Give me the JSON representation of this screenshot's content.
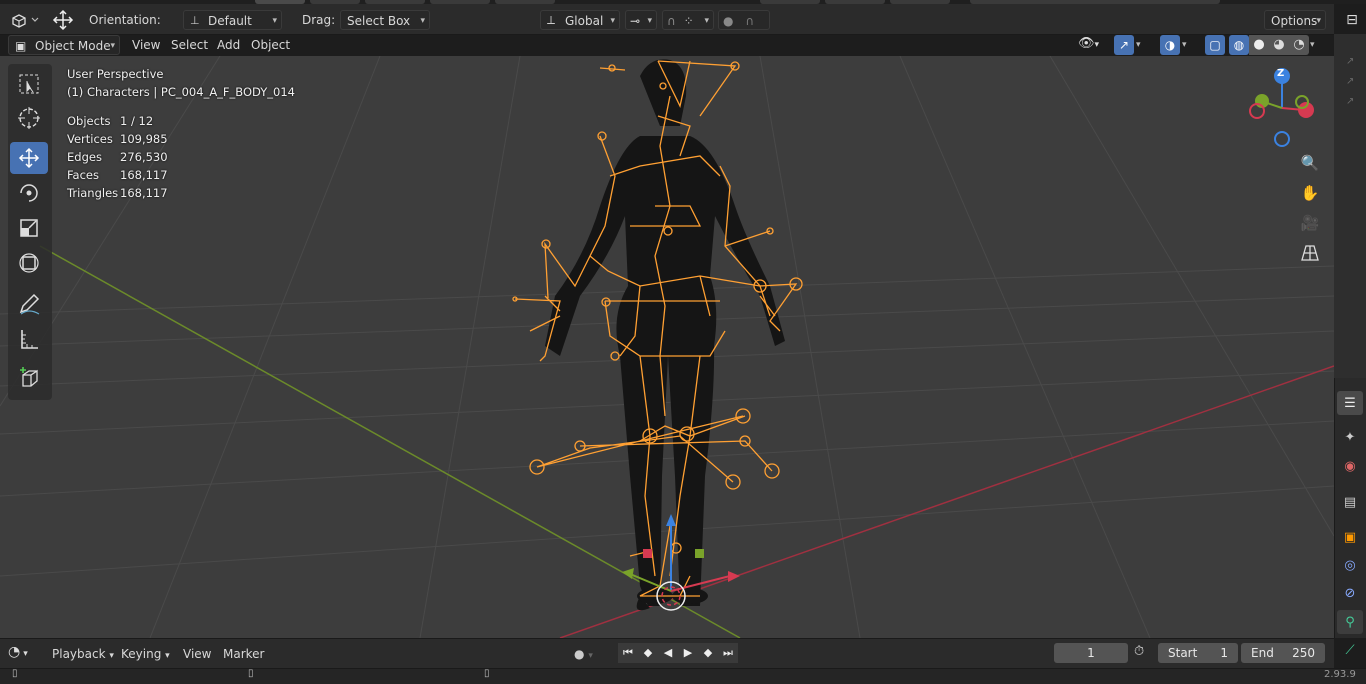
{
  "header": {
    "orientation_label": "Orientation:",
    "orientation_value": "Default",
    "drag_label": "Drag:",
    "drag_value": "Select Box",
    "transform_space": "Global",
    "options_label": "Options"
  },
  "viewport_header": {
    "mode": "Object Mode",
    "menu": [
      "View",
      "Select",
      "Add",
      "Object"
    ]
  },
  "overlay": {
    "perspective": "User Perspective",
    "collection": "(1) Characters | PC_004_A_F_BODY_014",
    "stats": [
      {
        "label": "Objects",
        "value": "1 / 12"
      },
      {
        "label": "Vertices",
        "value": "109,985"
      },
      {
        "label": "Edges",
        "value": "276,530"
      },
      {
        "label": "Faces",
        "value": "168,117"
      },
      {
        "label": "Triangles",
        "value": "168,117"
      }
    ]
  },
  "gizmo": {
    "z_label": "Z"
  },
  "timeline": {
    "menu": [
      "Playback",
      "Keying",
      "View",
      "Marker"
    ],
    "current_frame": "1",
    "start_label": "Start",
    "start_value": "1",
    "end_label": "End",
    "end_value": "250"
  },
  "status": {
    "version": "2.93.9"
  },
  "colors": {
    "accent": "#4772b3",
    "armature": "#ffa033",
    "viewport_bg": "#3d3d3d",
    "axis_x": "#d63a51",
    "axis_y": "#7aa32a",
    "axis_z": "#3b82e0"
  }
}
